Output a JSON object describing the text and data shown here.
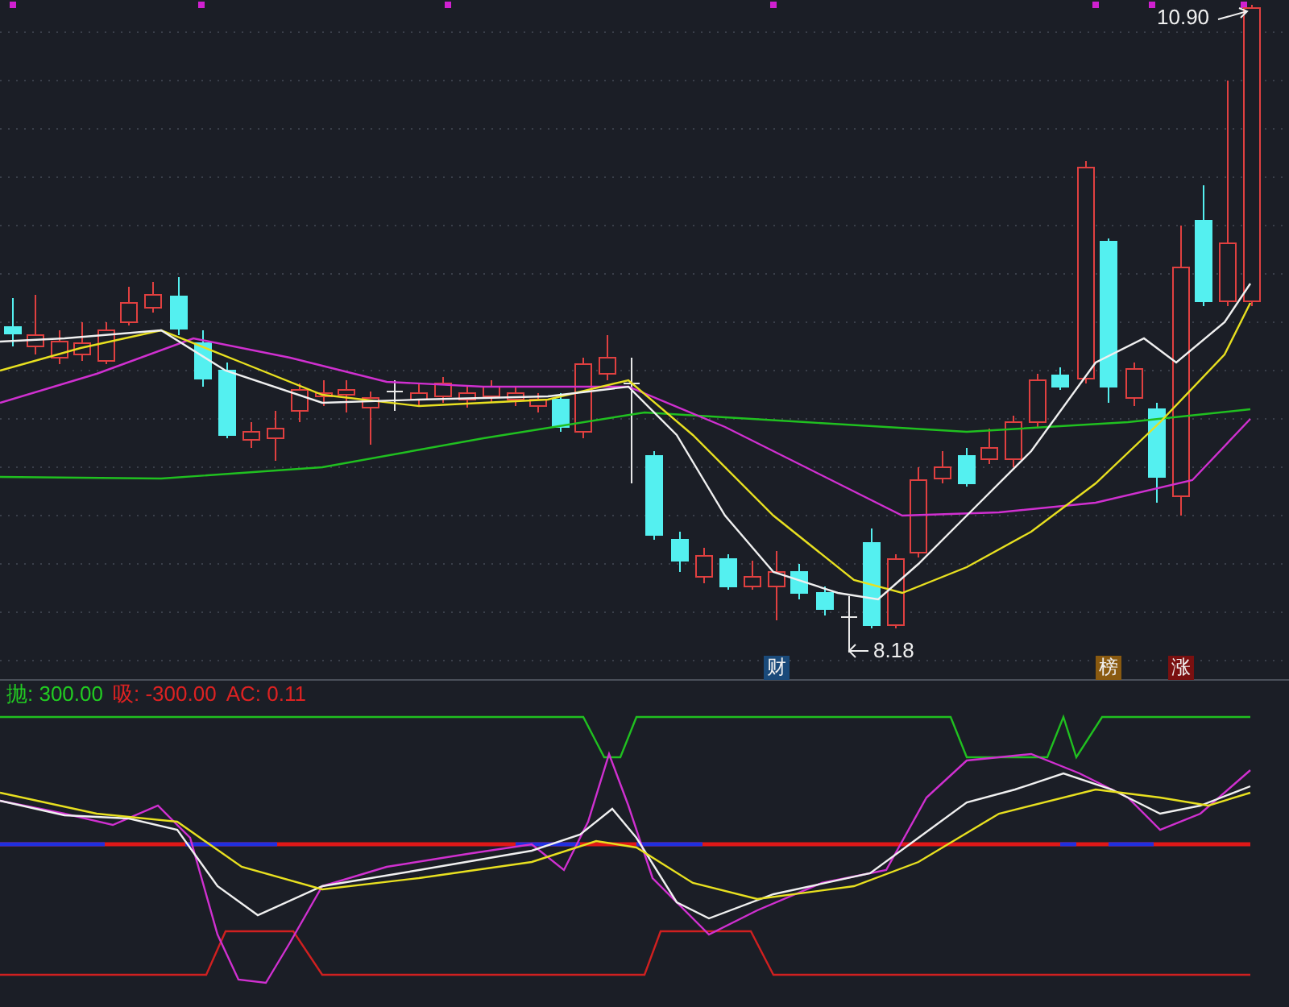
{
  "main_chart": {
    "high_label": "10.90",
    "low_label": "8.18",
    "badges": [
      {
        "text": "财",
        "color": "#1a4a7a"
      },
      {
        "text": "榜",
        "color": "#8a5a10"
      },
      {
        "text": "涨",
        "color": "#7a1010"
      }
    ]
  },
  "indicator": {
    "legend": [
      {
        "text": "抛: 300.00",
        "color": "#22cc22"
      },
      {
        "text": "吸: -300.00",
        "color": "#dd2222"
      },
      {
        "text": "AC: 0.11",
        "color": "#dd2222"
      }
    ]
  }
}
